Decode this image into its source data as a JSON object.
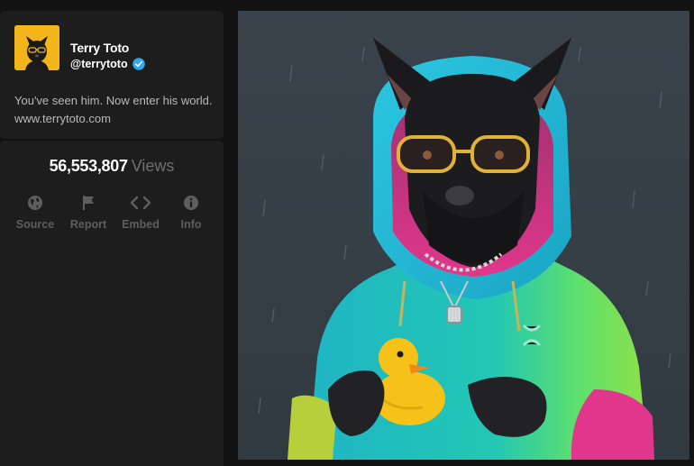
{
  "profile": {
    "name": "Terry Toto",
    "handle": "@terrytoto",
    "verified": true,
    "bio": "You've seen him. Now enter his world. www.terrytoto.com",
    "avatar_icon": "dog-with-glasses-avatar",
    "avatar_color": "#f3b51b",
    "verified_color": "#2ea8f0"
  },
  "stats": {
    "views_count": "56,553,807",
    "views_label": "Views"
  },
  "actions": [
    {
      "label": "Source",
      "icon": "globe-icon"
    },
    {
      "label": "Report",
      "icon": "flag-icon"
    },
    {
      "label": "Embed",
      "icon": "code-icon"
    },
    {
      "label": "Info",
      "icon": "info-icon"
    }
  ],
  "artwork": {
    "subject": "dog-in-hoodie-with-rubber-duck",
    "background_color": "#394149"
  }
}
